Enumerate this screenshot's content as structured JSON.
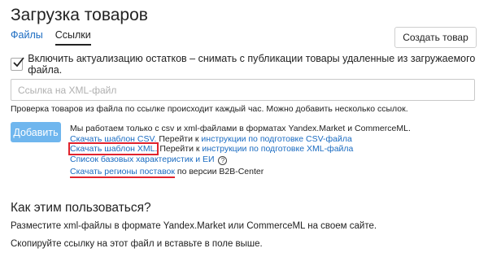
{
  "header": {
    "title": "Загрузка товаров",
    "create_button": "Создать товар"
  },
  "tabs": [
    {
      "label": "Файлы",
      "active": false
    },
    {
      "label": "Ссылки",
      "active": true
    }
  ],
  "update_option": {
    "checked": true,
    "label": "Включить актуализацию остатков – снимать с публикации товары удаленные из загружаемого файла."
  },
  "url_input": {
    "placeholder": "Ссылка на XML-файл",
    "value": ""
  },
  "hint": "Проверка товаров из файла по ссылке происходит каждый час. Можно добавить несколько ссылок.",
  "add_button": "Добавить",
  "info": {
    "intro": "Мы работаем только с csv и xml-файлами в форматах Yandex.Market и CommerceML.",
    "csv_template_link": "Скачать шаблон CSV.",
    "csv_goto_text": "Перейти к",
    "csv_instructions_link": "инструкции по подготовке CSV-файла",
    "xml_template_link": "Скачать шаблон XML.",
    "xml_goto_text": "Перейти к",
    "xml_instructions_link": "инструкции по подготовке XML-файла",
    "characteristics_link": "Список базовых характеристик и ЕИ",
    "regions_link": "Скачать регионы поставок",
    "regions_suffix": "по версии B2B-Center"
  },
  "how_to": {
    "title": "Как этим пользоваться?",
    "steps": [
      "Разместите xml-файлы в формате Yandex.Market или CommerceML на своем сайте.",
      "Скопируйте ссылку на этот файл и вставьте в поле выше."
    ]
  },
  "colors": {
    "link": "#1a6bc1",
    "primary_button": "#6fb6ee",
    "highlight": "#e0232d"
  }
}
